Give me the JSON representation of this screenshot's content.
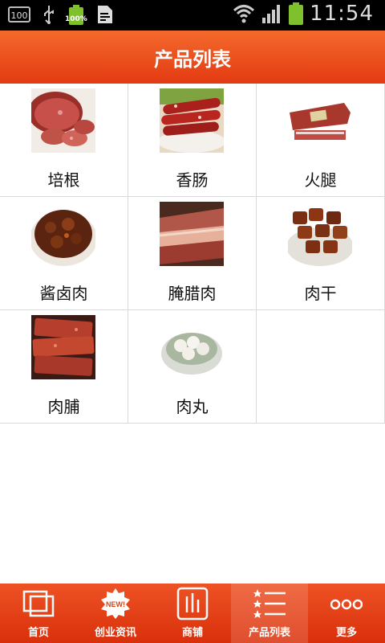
{
  "status_bar": {
    "box_label": "100",
    "battery_pct": "100%",
    "time": "11:54"
  },
  "header": {
    "title": "产品列表"
  },
  "products": [
    {
      "name": "培根"
    },
    {
      "name": "香肠"
    },
    {
      "name": "火腿"
    },
    {
      "name": "酱卤肉"
    },
    {
      "name": "腌腊肉"
    },
    {
      "name": "肉干"
    },
    {
      "name": "肉脯"
    },
    {
      "name": "肉丸"
    }
  ],
  "nav": {
    "items": [
      {
        "label": "首页",
        "icon": "screens-icon"
      },
      {
        "label": "创业资讯",
        "icon": "new-badge-icon"
      },
      {
        "label": "商铺",
        "icon": "shop-chart-icon"
      },
      {
        "label": "产品列表",
        "icon": "list-icon"
      },
      {
        "label": "更多",
        "icon": "more-dots-icon"
      }
    ],
    "active_index": 3
  },
  "colors": {
    "header": "#e84a1b",
    "nav": "#e1400f",
    "border": "#d9d9d9"
  }
}
